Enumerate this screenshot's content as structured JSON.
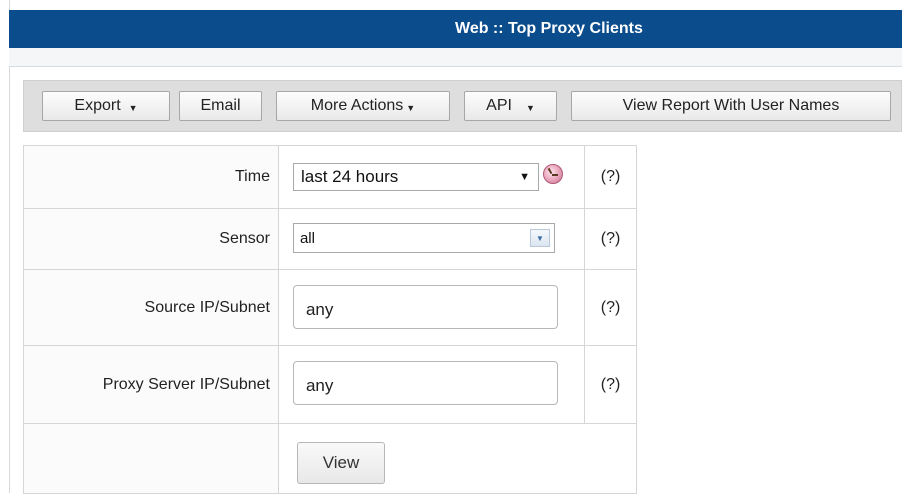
{
  "header": {
    "title": "Web :: Top Proxy Clients"
  },
  "toolbar": {
    "export_label": "Export",
    "email_label": "Email",
    "more_actions_label": "More Actions",
    "api_label": "API",
    "view_with_users_label": "View Report With User Names"
  },
  "form": {
    "time": {
      "label": "Time",
      "selected": "last 24 hours",
      "help": "(?)"
    },
    "sensor": {
      "label": "Sensor",
      "selected": "all",
      "help": "(?)"
    },
    "source": {
      "label": "Source IP/Subnet",
      "value": "any",
      "help": "(?)"
    },
    "proxy": {
      "label": "Proxy Server IP/Subnet",
      "value": "any",
      "help": "(?)"
    },
    "view_label": "View"
  },
  "colors": {
    "title_bar": "#0a4c8c",
    "toolbar_bg": "#dedede"
  },
  "icons": {
    "caret": "caret-down-icon",
    "clock": "clock-icon",
    "dropdown": "dropdown-arrow-icon"
  }
}
